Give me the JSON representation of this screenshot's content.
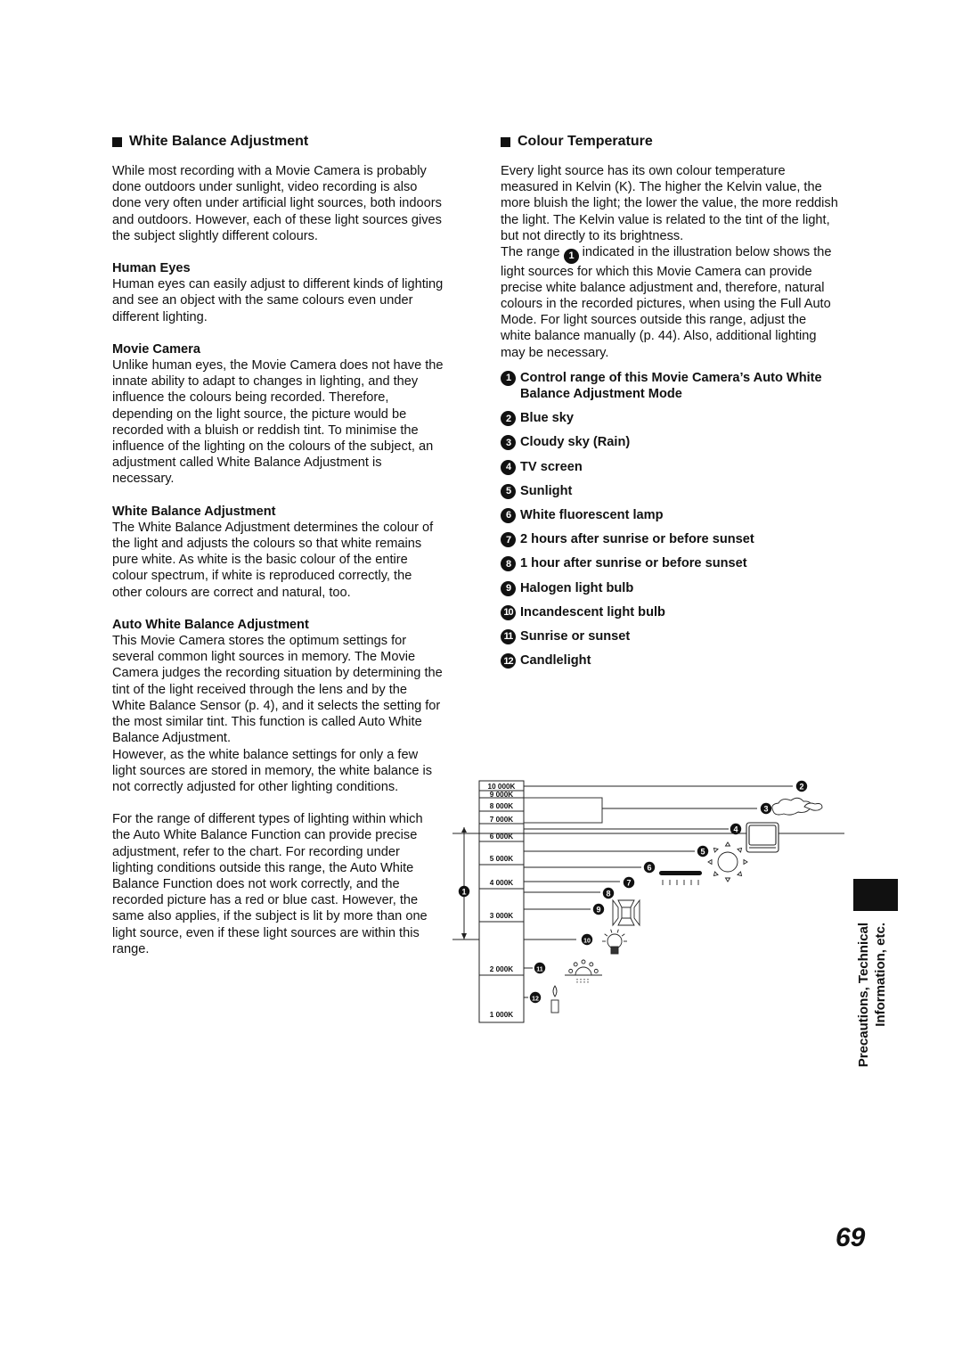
{
  "left": {
    "heading": "White Balance Adjustment",
    "intro": "While most recording with a Movie Camera is probably done outdoors under sunlight, video recording is also done very often under artificial light sources, both indoors and outdoors. However, each of these light sources gives the subject slightly different colours.",
    "sections": [
      {
        "title": "Human Eyes",
        "text": "Human eyes can easily adjust to different kinds of lighting and see an object with the same colours even under different lighting."
      },
      {
        "title": "Movie Camera",
        "text": "Unlike human eyes, the Movie Camera does not have the innate ability to adapt to changes in lighting, and they influence the colours being recorded. Therefore, depending on the light source, the picture would be recorded with a bluish or reddish tint. To minimise the influence of the lighting on the colours of the subject, an adjustment called White Balance Adjustment is necessary."
      },
      {
        "title": "White Balance Adjustment",
        "text": "The White Balance Adjustment determines the colour of the light and adjusts the colours so that white remains pure white. As white is the basic colour of the entire colour spectrum, if white is reproduced correctly, the other colours are correct and natural, too."
      },
      {
        "title": "Auto White Balance Adjustment",
        "text": "This Movie Camera stores the optimum settings for several common light sources in memory. The Movie Camera judges the recording situation by determining the tint of the light received through the lens and by the White Balance Sensor (p. 4), and it selects the setting for the most similar tint. This function is called Auto White Balance Adjustment.",
        "text2": "However, as the white balance settings for only a few light sources are stored in memory, the white balance is not correctly adjusted for other lighting conditions."
      }
    ],
    "closing": "For the range of different types of lighting within which the Auto White Balance Function can provide precise adjustment, refer to the chart. For recording under lighting conditions outside this range, the Auto White Balance Function does not work correctly, and the recorded picture has a red or blue cast. However, the same also applies, if the subject is lit by more than one light source, even if these light sources are within this range."
  },
  "right": {
    "heading": "Colour Temperature",
    "intro": "Every light source has its own colour temperature measured in Kelvin (K). The higher the Kelvin value, the more bluish the light; the lower the value, the more reddish the light. The Kelvin value is related to the tint of the light, but not directly to its brightness.",
    "range_pre": "The range",
    "range_marker": "1",
    "range_post": "indicated in the illustration below shows the light sources for which this Movie Camera can provide precise white balance adjustment and, therefore, natural colours in the recorded pictures, when using the Full Auto Mode. For light sources outside this range, adjust the white balance manually (p. 44). Also, additional lighting may be necessary.",
    "legend": [
      {
        "n": "1",
        "label": "Control range of this Movie Camera’s Auto White Balance Adjustment Mode"
      },
      {
        "n": "2",
        "label": "Blue sky"
      },
      {
        "n": "3",
        "label": "Cloudy sky (Rain)"
      },
      {
        "n": "4",
        "label": "TV screen"
      },
      {
        "n": "5",
        "label": "Sunlight"
      },
      {
        "n": "6",
        "label": "White fluorescent lamp"
      },
      {
        "n": "7",
        "label": "2 hours after sunrise or before sunset"
      },
      {
        "n": "8",
        "label": "1 hour after sunrise or before sunset"
      },
      {
        "n": "9",
        "label": "Halogen light bulb"
      },
      {
        "n": "10",
        "label": "Incandescent light bulb"
      },
      {
        "n": "11",
        "label": "Sunrise or sunset"
      },
      {
        "n": "12",
        "label": "Candlelight"
      }
    ]
  },
  "diagram": {
    "scale_labels": [
      "10 000K",
      "9 000K",
      "8 000K",
      "7 000K",
      "6 000K",
      "5 000K",
      "4 000K",
      "3 000K",
      "2 000K",
      "1 000K"
    ],
    "range_marker": "1",
    "control_range_kelvin": [
      2500,
      6500
    ],
    "sources": [
      {
        "n": "2",
        "name": "blue-sky",
        "kelvin": 10000,
        "icon": "none"
      },
      {
        "n": "3",
        "name": "cloudy-sky",
        "kelvin": [
          7000,
          9000
        ],
        "icon": "cloud-icon"
      },
      {
        "n": "4",
        "name": "tv-screen",
        "kelvin": 6500,
        "icon": "tv-icon"
      },
      {
        "n": "5",
        "name": "sunlight",
        "kelvin": 5500,
        "icon": "sun-icon"
      },
      {
        "n": "6",
        "name": "fluorescent",
        "kelvin": 4500,
        "icon": "fluorescent-lamp-icon"
      },
      {
        "n": "7",
        "name": "2h-after-sunrise",
        "kelvin": 4000,
        "icon": "none"
      },
      {
        "n": "8",
        "name": "1h-after-sunrise",
        "kelvin": 3500,
        "icon": "none"
      },
      {
        "n": "9",
        "name": "halogen",
        "kelvin": 3100,
        "icon": "halogen-lamp-icon"
      },
      {
        "n": "10",
        "name": "incandescent",
        "kelvin": 2500,
        "icon": "light-bulb-icon"
      },
      {
        "n": "11",
        "name": "sunrise-sunset",
        "kelvin": 2000,
        "icon": "sunrise-icon"
      },
      {
        "n": "12",
        "name": "candlelight",
        "kelvin": 1500,
        "icon": "candle-icon"
      }
    ]
  },
  "side": {
    "line1": "Precautions, Technical",
    "line2": "Information, etc."
  },
  "page_number": "69"
}
